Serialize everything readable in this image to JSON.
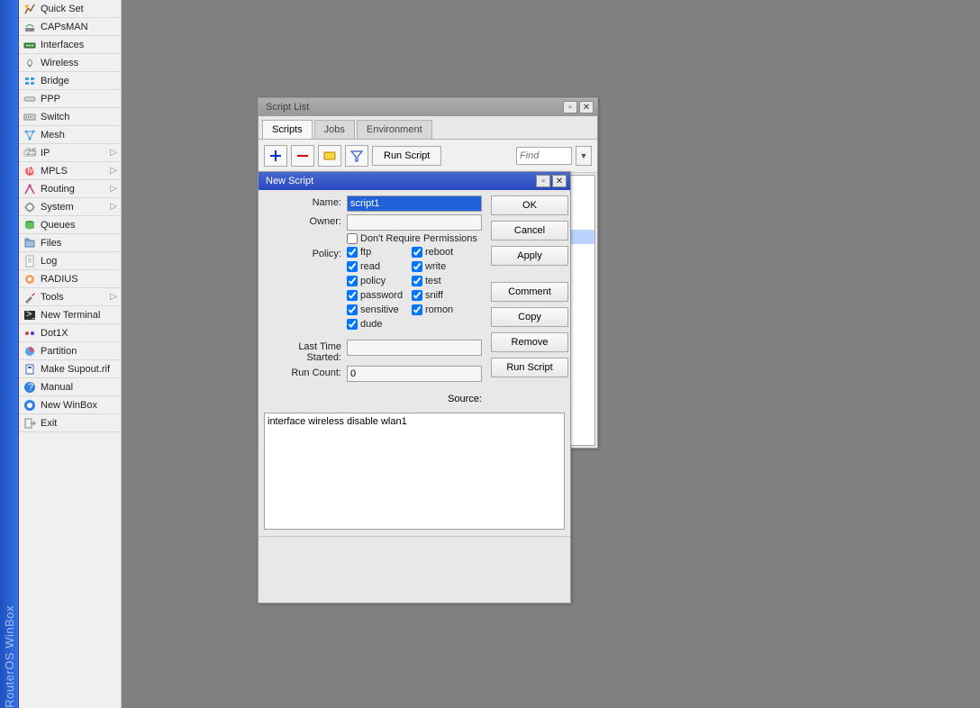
{
  "brand": "RouterOS WinBox",
  "sidebar": {
    "items": [
      {
        "label": "Quick Set",
        "icon": "quickset",
        "expand": false
      },
      {
        "label": "CAPsMAN",
        "icon": "capsman",
        "expand": false
      },
      {
        "label": "Interfaces",
        "icon": "interfaces",
        "expand": false
      },
      {
        "label": "Wireless",
        "icon": "wireless",
        "expand": false
      },
      {
        "label": "Bridge",
        "icon": "bridge",
        "expand": false
      },
      {
        "label": "PPP",
        "icon": "ppp",
        "expand": false
      },
      {
        "label": "Switch",
        "icon": "switch",
        "expand": false
      },
      {
        "label": "Mesh",
        "icon": "mesh",
        "expand": false
      },
      {
        "label": "IP",
        "icon": "ip",
        "expand": true
      },
      {
        "label": "MPLS",
        "icon": "mpls",
        "expand": true
      },
      {
        "label": "Routing",
        "icon": "routing",
        "expand": true
      },
      {
        "label": "System",
        "icon": "system",
        "expand": true
      },
      {
        "label": "Queues",
        "icon": "queues",
        "expand": false
      },
      {
        "label": "Files",
        "icon": "files",
        "expand": false
      },
      {
        "label": "Log",
        "icon": "log",
        "expand": false
      },
      {
        "label": "RADIUS",
        "icon": "radius",
        "expand": false
      },
      {
        "label": "Tools",
        "icon": "tools",
        "expand": true
      },
      {
        "label": "New Terminal",
        "icon": "terminal",
        "expand": false
      },
      {
        "label": "Dot1X",
        "icon": "dot1x",
        "expand": false
      },
      {
        "label": "Partition",
        "icon": "partition",
        "expand": false
      },
      {
        "label": "Make Supout.rif",
        "icon": "supout",
        "expand": false
      },
      {
        "label": "Manual",
        "icon": "manual",
        "expand": false
      },
      {
        "label": "New WinBox",
        "icon": "newwinbox",
        "expand": false
      },
      {
        "label": "Exit",
        "icon": "exit",
        "expand": false
      }
    ]
  },
  "script_list": {
    "title": "Script List",
    "tabs": [
      "Scripts",
      "Jobs",
      "Environment"
    ],
    "active_tab": 0,
    "run_button": "Run Script",
    "find_placeholder": "Find"
  },
  "new_script": {
    "title": "New Script",
    "labels": {
      "name": "Name:",
      "owner": "Owner:",
      "dont_require": "Don't Require Permissions",
      "policy": "Policy:",
      "last_started": "Last Time Started:",
      "run_count": "Run Count:",
      "source": "Source:"
    },
    "values": {
      "name": "script1",
      "owner": "",
      "last_started": "",
      "run_count": "0",
      "source": "interface wireless disable wlan1"
    },
    "policies": [
      {
        "label": "ftp",
        "checked": true
      },
      {
        "label": "reboot",
        "checked": true
      },
      {
        "label": "read",
        "checked": true
      },
      {
        "label": "write",
        "checked": true
      },
      {
        "label": "policy",
        "checked": true
      },
      {
        "label": "test",
        "checked": true
      },
      {
        "label": "password",
        "checked": true
      },
      {
        "label": "sniff",
        "checked": true
      },
      {
        "label": "sensitive",
        "checked": true
      },
      {
        "label": "romon",
        "checked": true
      },
      {
        "label": "dude",
        "checked": true
      }
    ],
    "buttons": {
      "ok": "OK",
      "cancel": "Cancel",
      "apply": "Apply",
      "comment": "Comment",
      "copy": "Copy",
      "remove": "Remove",
      "run": "Run Script"
    }
  }
}
